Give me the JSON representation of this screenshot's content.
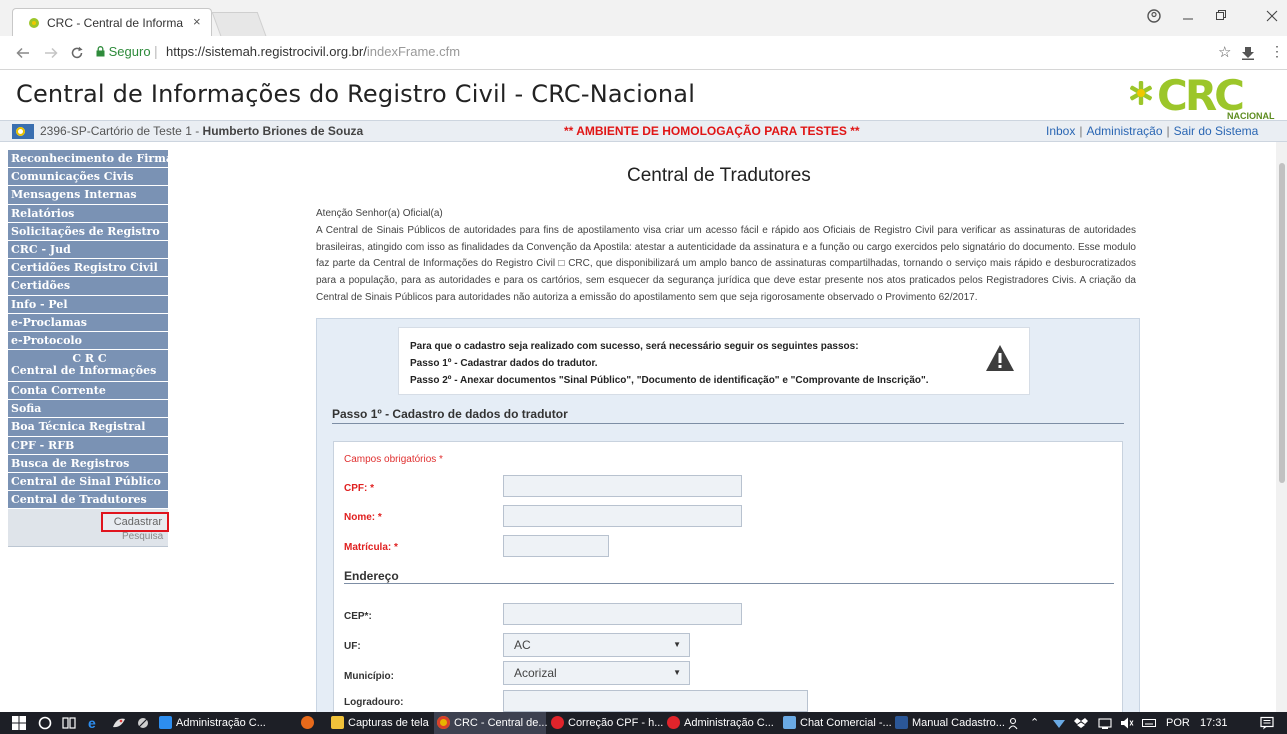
{
  "browser": {
    "tab_title": "CRC - Central de Informa",
    "tab_close": "×",
    "secure_label": "Seguro",
    "url_base": "https://sistemah.registrocivil.org.br/",
    "url_path": "indexFrame.cfm"
  },
  "header": {
    "title": "Central de Informações do Registro Civil - CRC-Nacional",
    "logo_text": "CRC",
    "logo_sub": "NACIONAL"
  },
  "infobar": {
    "office": "2396-SP-Cartório de Teste 1 - ",
    "user": "Humberto Briones de Souza",
    "environment": "** AMBIENTE DE HOMOLOGAÇÃO PARA TESTES **",
    "links": [
      "Inbox",
      "Administração",
      "Sair do Sistema"
    ]
  },
  "sidebar": {
    "items": [
      "Reconhecimento de Firma",
      "Comunicações Civis",
      "Mensagens Internas",
      "Relatórios",
      "Solicitações de Registro",
      "CRC - Jud",
      "Certidões Registro Civil",
      "Certidões",
      "Info - Pel",
      "e-Proclamas",
      "e-Protocolo"
    ],
    "crc_line1": "C R C",
    "crc_line2": "Central de Informações",
    "items2": [
      "Conta Corrente",
      "Sofia",
      "Boa Técnica Registral",
      "CPF - RFB",
      "Busca de Registros",
      "Central de Sinal Público",
      "Central de Tradutores"
    ],
    "sub_cadastrar": "Cadastrar",
    "sub_pesquisa": "Pesquisa"
  },
  "main": {
    "title": "Central de Tradutores",
    "notice_title": "Atenção Senhor(a) Oficial(a)",
    "notice_body": "A Central de Sinais Públicos de autoridades para fins de apostilamento visa criar um acesso fácil e rápido aos Oficiais de Registro Civil para verificar as assinaturas de autoridades brasileiras, atingido com isso as finalidades da Convenção da Apostila: atestar a autenticidade da assinatura e a função ou cargo exercidos pelo signatário do documento. Esse modulo faz parte da Central de Informações do Registro Civil □ CRC, que disponibilizará um amplo banco de assinaturas compartilhadas, tornando o serviço mais rápido e desburocratizados para a população, para as autoridades e para os cartórios, sem esquecer da segurança jurídica que deve estar presente nos atos praticados pelos Registradores Civis. A criação da Central de Sinais Públicos para autoridades não autoriza a emissão do apostilamento sem que seja rigorosamente observado o Provimento 62/2017.",
    "steps_intro": "Para que o cadastro seja realizado com sucesso, será necessário seguir os seguintes passos:",
    "step1": "Passo 1º - Cadastrar dados do tradutor.",
    "step2": "Passo 2º - Anexar documentos \"Sinal Público\", \"Documento de identificação\" e \"Comprovante de Inscrição\".",
    "step_header": "Passo 1º - Cadastro de dados do tradutor",
    "required_note": "Campos obrigatórios *",
    "labels": {
      "cpf": "CPF: *",
      "nome": "Nome: *",
      "matricula": "Matrícula: *",
      "endereco": "Endereço",
      "cep": "CEP*:",
      "uf": "UF:",
      "municipio": "Município:",
      "logradouro": "Logradouro:"
    },
    "values": {
      "uf": "AC",
      "municipio": "Acorizal"
    }
  },
  "taskbar": {
    "items": [
      "Administração C...",
      "Capturas de tela",
      "CRC - Central de...",
      "Correção CPF - h...",
      "Administração C...",
      "Chat Comercial -...",
      "Manual Cadastro..."
    ],
    "lang": "POR",
    "time": "17:31"
  }
}
